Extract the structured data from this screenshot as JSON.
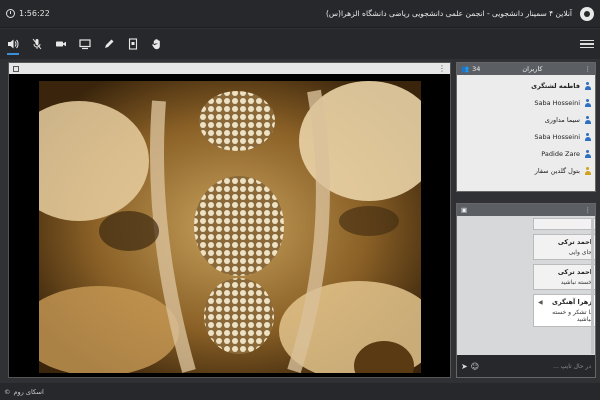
{
  "titlebar": {
    "time": "1:56:22",
    "title": "آنلاین ۴ سمینار دانشجویی - انجمن علمی دانشجویی ریاضی دانشگاه الزهرا(س)"
  },
  "toolbar": {
    "tools": [
      "speaker-icon",
      "mic-muted-icon",
      "camera-icon",
      "screen-share-icon",
      "pen-icon",
      "file-icon",
      "raise-hand-icon"
    ],
    "active_tool": "speaker-icon"
  },
  "users": {
    "count": "34",
    "header": "کاربران",
    "list": [
      {
        "name": "فاطمه لشتگری",
        "color": "#2f6fc0"
      },
      {
        "name": "Saba Hosseini",
        "color": "#2f6fc0"
      },
      {
        "name": "سیما مداوری",
        "color": "#2f6fc0"
      },
      {
        "name": "Saba Hosseini",
        "color": "#2f6fc0"
      },
      {
        "name": "Padide Zare",
        "color": "#2f6fc0"
      },
      {
        "name": "بتول گلدین سفار",
        "color": "#d1a11c"
      }
    ]
  },
  "chat": {
    "messages": [
      {
        "author": "",
        "text": "",
        "partial": true
      },
      {
        "author": "احمد ترکی",
        "text": "جای وایی"
      },
      {
        "author": "احمد ترکی",
        "text": "خسته نباشید"
      },
      {
        "author": "زهرا آهنگری",
        "text": "با تشکر و خسته نباشید",
        "mine": true
      }
    ],
    "input_placeholder": "در حال تایپ ..."
  },
  "footer": {
    "brand": "اسکای روم"
  },
  "colors": {
    "accent": "#3a8fd6",
    "bar": "#26282b"
  }
}
